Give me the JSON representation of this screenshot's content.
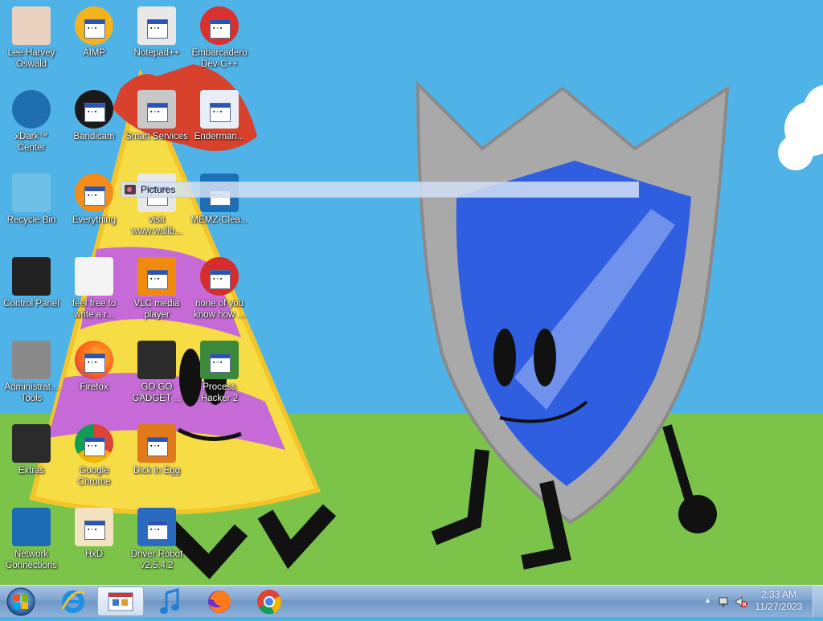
{
  "desktop": {
    "icons": [
      {
        "label": "Lee Harvey Oswald",
        "icon": "anime-character-icon"
      },
      {
        "label": "AIMP",
        "icon": "aimp-icon"
      },
      {
        "label": "Notepad++",
        "icon": "notepadpp-icon"
      },
      {
        "label": "Embarcadero Dev-C++",
        "icon": "devcpp-icon"
      },
      {
        "label": "xDark™ Center",
        "icon": "xdark-icon"
      },
      {
        "label": "Bandicam",
        "icon": "bandicam-icon"
      },
      {
        "label": "Smart Services",
        "icon": "smart-services-icon"
      },
      {
        "label": "Enderman...",
        "icon": "program-window-icon"
      },
      {
        "label": "Recycle Bin",
        "icon": "recycle-bin-icon"
      },
      {
        "label": "Everything",
        "icon": "everything-search-icon"
      },
      {
        "label": "visit www.wallb...",
        "icon": "url-shortcut-icon"
      },
      {
        "label": "MEMZ-Clea...",
        "icon": "memz-icon"
      },
      {
        "label": "Control Panel",
        "icon": "control-panel-icon"
      },
      {
        "label": "feel free to write a r...",
        "icon": "text-document-icon"
      },
      {
        "label": "VLC media player",
        "icon": "vlc-icon"
      },
      {
        "label": "none of you know how ...",
        "icon": "program-icon"
      },
      {
        "label": "Administrat... Tools",
        "icon": "admin-tools-icon"
      },
      {
        "label": "Firefox",
        "icon": "firefox-icon"
      },
      {
        "label": "GO GO GADGET ...",
        "icon": "dark-folder-icon"
      },
      {
        "label": "Process Hacker 2",
        "icon": "process-hacker-icon"
      },
      {
        "label": "Extras",
        "icon": "dark-folder-icon"
      },
      {
        "label": "Google Chrome",
        "icon": "chrome-icon"
      },
      {
        "label": "Dick in Egg",
        "icon": "egg-app-icon"
      },
      {
        "label": "Network Connections",
        "icon": "network-icon"
      },
      {
        "label": "HxD",
        "icon": "hxd-icon"
      },
      {
        "label": "Driver Robot v2.5.4.2",
        "icon": "driver-robot-icon"
      }
    ],
    "pictures_tooltip": "Pictures"
  },
  "taskbar": {
    "pinned": [
      {
        "name": "internet-explorer",
        "icon": "internet-explorer-icon"
      },
      {
        "name": "paint",
        "icon": "paint-icon",
        "active": true
      },
      {
        "name": "music",
        "icon": "music-note-icon"
      },
      {
        "name": "firefox",
        "icon": "firefox-icon"
      },
      {
        "name": "chrome",
        "icon": "chrome-icon"
      }
    ],
    "clock": {
      "time": "2:33 AM",
      "date": "11/27/2023"
    }
  },
  "colors": {
    "sky": "#4fb3e8",
    "grass": "#7cc34a",
    "shield_blue": "#2f5fe0",
    "hat_yellow": "#f6dc45",
    "hat_stripe": "#c56ad6"
  }
}
